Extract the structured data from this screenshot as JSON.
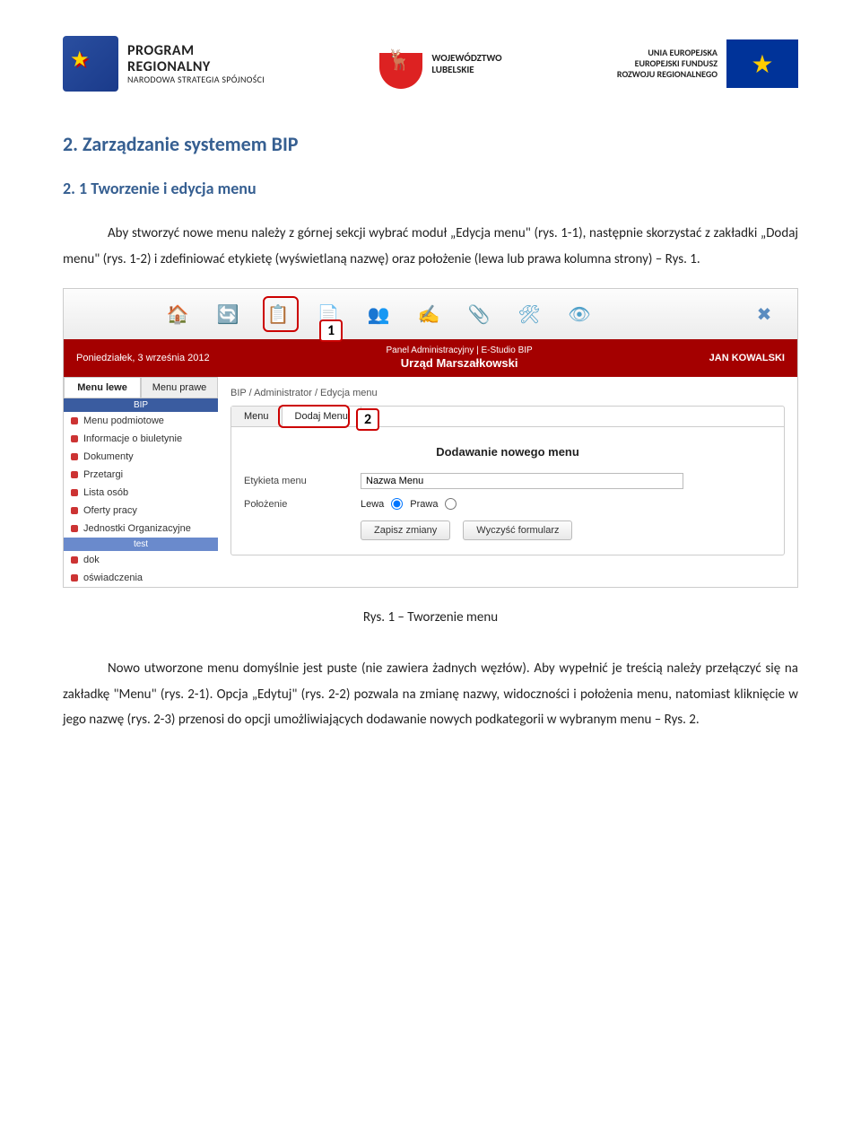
{
  "header": {
    "program_title": "PROGRAM",
    "program_title2": "REGIONALNY",
    "program_sub": "NARODOWA STRATEGIA SPÓJNOŚCI",
    "woj1": "WOJEWÓDZTWO",
    "woj2": "LUBELSKIE",
    "eu1": "UNIA EUROPEJSKA",
    "eu2": "EUROPEJSKI FUNDUSZ",
    "eu3": "ROZWOJU REGIONALNEGO"
  },
  "section_title": "2. Zarządzanie systemem BIP",
  "subsection_title": "2. 1 Tworzenie i edycja menu",
  "para1": "Aby stworzyć nowe menu należy z górnej sekcji wybrać moduł „Edycja menu\" (rys. 1-1), następnie skorzystać z zakładki „Dodaj menu\" (rys. 1-2) i zdefiniować etykietę (wyświetlaną nazwę) oraz położenie (lewa lub prawa kolumna strony) – Rys. 1.",
  "callouts": {
    "c1": "1",
    "c2": "2"
  },
  "shot": {
    "date": "Poniedziałek, 3 września 2012",
    "panel_line1": "Panel Administracyjny | E-Studio BIP",
    "panel_line2": "Urząd Marszałkowski",
    "username": "JAN KOWALSKI",
    "side_tab_left": "Menu lewe",
    "side_tab_right": "Menu prawe",
    "side_head1": "BIP",
    "side_items": [
      "Menu podmiotowe",
      "Informacje o biuletynie",
      "Dokumenty",
      "Przetargi",
      "Lista osób",
      "Oferty pracy",
      "Jednostki Organizacyjne"
    ],
    "side_head2": "test",
    "side_items2": [
      "dok",
      "oświadczenia"
    ],
    "crumb": "BIP  /  Administrator  /  Edycja menu",
    "ptab_menu": "Menu",
    "ptab_dodaj": "Dodaj Menu",
    "form_title": "Dodawanie nowego menu",
    "lbl_etykieta": "Etykieta menu",
    "lbl_polozenie": "Położenie",
    "input_value": "Nazwa Menu",
    "radio_lewa": "Lewa",
    "radio_prawa": "Prawa",
    "btn_save": "Zapisz zmiany",
    "btn_clear": "Wyczyść formularz"
  },
  "fig_caption": "Rys. 1 – Tworzenie menu",
  "para2": "Nowo utworzone menu domyślnie jest puste (nie zawiera żadnych węzłów). Aby wypełnić je treścią należy przełączyć się na zakładkę \"Menu\" (rys. 2-1). Opcja „Edytuj\" (rys. 2-2) pozwala na zmianę nazwy, widoczności i  położenia menu, natomiast kliknięcie w jego nazwę (rys. 2-3) przenosi do opcji umożliwiających dodawanie nowych podkategorii w wybranym menu – Rys. 2."
}
